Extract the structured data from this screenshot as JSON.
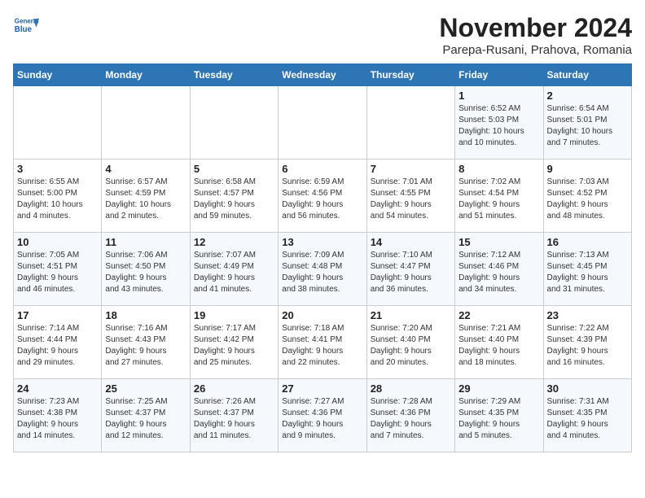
{
  "header": {
    "logo_line1": "General",
    "logo_line2": "Blue",
    "month_title": "November 2024",
    "location": "Parepa-Rusani, Prahova, Romania"
  },
  "weekdays": [
    "Sunday",
    "Monday",
    "Tuesday",
    "Wednesday",
    "Thursday",
    "Friday",
    "Saturday"
  ],
  "weeks": [
    [
      {
        "day": "",
        "info": ""
      },
      {
        "day": "",
        "info": ""
      },
      {
        "day": "",
        "info": ""
      },
      {
        "day": "",
        "info": ""
      },
      {
        "day": "",
        "info": ""
      },
      {
        "day": "1",
        "info": "Sunrise: 6:52 AM\nSunset: 5:03 PM\nDaylight: 10 hours\nand 10 minutes."
      },
      {
        "day": "2",
        "info": "Sunrise: 6:54 AM\nSunset: 5:01 PM\nDaylight: 10 hours\nand 7 minutes."
      }
    ],
    [
      {
        "day": "3",
        "info": "Sunrise: 6:55 AM\nSunset: 5:00 PM\nDaylight: 10 hours\nand 4 minutes."
      },
      {
        "day": "4",
        "info": "Sunrise: 6:57 AM\nSunset: 4:59 PM\nDaylight: 10 hours\nand 2 minutes."
      },
      {
        "day": "5",
        "info": "Sunrise: 6:58 AM\nSunset: 4:57 PM\nDaylight: 9 hours\nand 59 minutes."
      },
      {
        "day": "6",
        "info": "Sunrise: 6:59 AM\nSunset: 4:56 PM\nDaylight: 9 hours\nand 56 minutes."
      },
      {
        "day": "7",
        "info": "Sunrise: 7:01 AM\nSunset: 4:55 PM\nDaylight: 9 hours\nand 54 minutes."
      },
      {
        "day": "8",
        "info": "Sunrise: 7:02 AM\nSunset: 4:54 PM\nDaylight: 9 hours\nand 51 minutes."
      },
      {
        "day": "9",
        "info": "Sunrise: 7:03 AM\nSunset: 4:52 PM\nDaylight: 9 hours\nand 48 minutes."
      }
    ],
    [
      {
        "day": "10",
        "info": "Sunrise: 7:05 AM\nSunset: 4:51 PM\nDaylight: 9 hours\nand 46 minutes."
      },
      {
        "day": "11",
        "info": "Sunrise: 7:06 AM\nSunset: 4:50 PM\nDaylight: 9 hours\nand 43 minutes."
      },
      {
        "day": "12",
        "info": "Sunrise: 7:07 AM\nSunset: 4:49 PM\nDaylight: 9 hours\nand 41 minutes."
      },
      {
        "day": "13",
        "info": "Sunrise: 7:09 AM\nSunset: 4:48 PM\nDaylight: 9 hours\nand 38 minutes."
      },
      {
        "day": "14",
        "info": "Sunrise: 7:10 AM\nSunset: 4:47 PM\nDaylight: 9 hours\nand 36 minutes."
      },
      {
        "day": "15",
        "info": "Sunrise: 7:12 AM\nSunset: 4:46 PM\nDaylight: 9 hours\nand 34 minutes."
      },
      {
        "day": "16",
        "info": "Sunrise: 7:13 AM\nSunset: 4:45 PM\nDaylight: 9 hours\nand 31 minutes."
      }
    ],
    [
      {
        "day": "17",
        "info": "Sunrise: 7:14 AM\nSunset: 4:44 PM\nDaylight: 9 hours\nand 29 minutes."
      },
      {
        "day": "18",
        "info": "Sunrise: 7:16 AM\nSunset: 4:43 PM\nDaylight: 9 hours\nand 27 minutes."
      },
      {
        "day": "19",
        "info": "Sunrise: 7:17 AM\nSunset: 4:42 PM\nDaylight: 9 hours\nand 25 minutes."
      },
      {
        "day": "20",
        "info": "Sunrise: 7:18 AM\nSunset: 4:41 PM\nDaylight: 9 hours\nand 22 minutes."
      },
      {
        "day": "21",
        "info": "Sunrise: 7:20 AM\nSunset: 4:40 PM\nDaylight: 9 hours\nand 20 minutes."
      },
      {
        "day": "22",
        "info": "Sunrise: 7:21 AM\nSunset: 4:40 PM\nDaylight: 9 hours\nand 18 minutes."
      },
      {
        "day": "23",
        "info": "Sunrise: 7:22 AM\nSunset: 4:39 PM\nDaylight: 9 hours\nand 16 minutes."
      }
    ],
    [
      {
        "day": "24",
        "info": "Sunrise: 7:23 AM\nSunset: 4:38 PM\nDaylight: 9 hours\nand 14 minutes."
      },
      {
        "day": "25",
        "info": "Sunrise: 7:25 AM\nSunset: 4:37 PM\nDaylight: 9 hours\nand 12 minutes."
      },
      {
        "day": "26",
        "info": "Sunrise: 7:26 AM\nSunset: 4:37 PM\nDaylight: 9 hours\nand 11 minutes."
      },
      {
        "day": "27",
        "info": "Sunrise: 7:27 AM\nSunset: 4:36 PM\nDaylight: 9 hours\nand 9 minutes."
      },
      {
        "day": "28",
        "info": "Sunrise: 7:28 AM\nSunset: 4:36 PM\nDaylight: 9 hours\nand 7 minutes."
      },
      {
        "day": "29",
        "info": "Sunrise: 7:29 AM\nSunset: 4:35 PM\nDaylight: 9 hours\nand 5 minutes."
      },
      {
        "day": "30",
        "info": "Sunrise: 7:31 AM\nSunset: 4:35 PM\nDaylight: 9 hours\nand 4 minutes."
      }
    ]
  ]
}
